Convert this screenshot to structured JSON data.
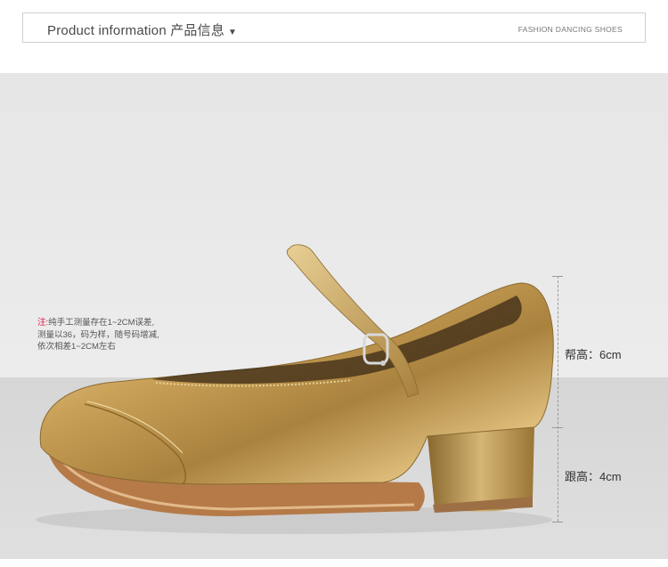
{
  "header": {
    "title": "Product information 产品信息",
    "caret": "▼",
    "tag": "FASHION DANCING SHOES"
  },
  "note": {
    "label": "注:",
    "line1": "纯手工测量存在1~2CM误差,",
    "line2": "测量以36，码为样，随号码增减,",
    "line3": "依次相差1~2CM左右"
  },
  "measurements": {
    "upper": "帮高：6cm",
    "heel": "跟高：4cm"
  },
  "colors": {
    "gold": "#c8a257",
    "note_label": "#d40f3a"
  }
}
